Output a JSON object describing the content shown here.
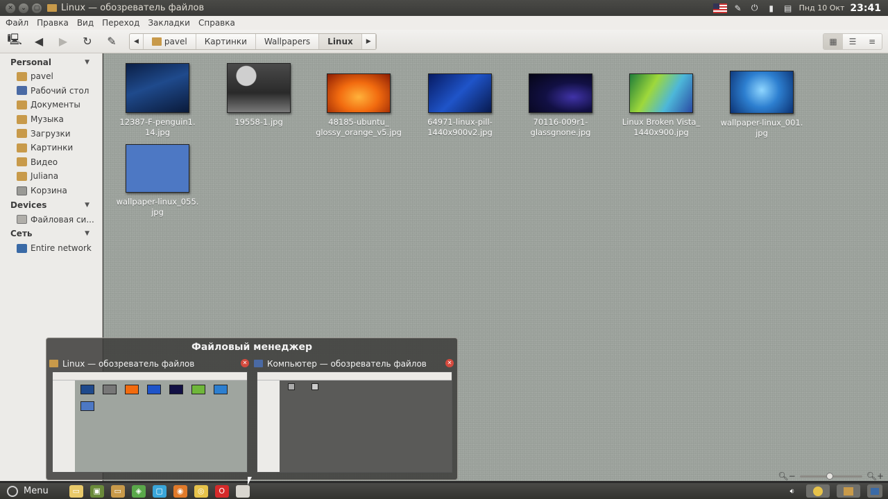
{
  "window": {
    "title": "Linux — обозреватель файлов"
  },
  "tray": {
    "date": "Пнд 10 Окт",
    "time": "23:41"
  },
  "menu": [
    "Файл",
    "Правка",
    "Вид",
    "Переход",
    "Закладки",
    "Справка"
  ],
  "breadcrumb": [
    "pavel",
    "Картинки",
    "Wallpapers",
    "Linux"
  ],
  "sidebar": {
    "personal_header": "Personal",
    "personal": [
      "pavel",
      "Рабочий стол",
      "Документы",
      "Музыка",
      "Загрузки",
      "Картинки",
      "Видео",
      "Juliana",
      "Корзина"
    ],
    "devices_header": "Devices",
    "devices": [
      "Файловая си..."
    ],
    "network_header": "Сеть",
    "network": [
      "Entire network"
    ]
  },
  "files": [
    {
      "name": "12387-F-penguin1.\n14.jpg"
    },
    {
      "name": "19558-1.jpg"
    },
    {
      "name": "48185-ubuntu_\nglossy_orange_v5.jpg"
    },
    {
      "name": "64971-linux-pill-\n1440x900v2.jpg"
    },
    {
      "name": "70116-009r1-\nglassgnone.jpg"
    },
    {
      "name": "Linux Broken Vista_\n1440x900.jpg"
    },
    {
      "name": "wallpaper-linux_001.\njpg"
    },
    {
      "name": "wallpaper-linux_055.\njpg"
    }
  ],
  "switcher": {
    "title": "Файловый менеджер",
    "windows": [
      {
        "title": "Linux — обозреватель файлов"
      },
      {
        "title": "Компьютер — обозреватель файлов"
      }
    ]
  },
  "statusbar": {
    "zoom_level": 0.48
  },
  "taskbar": {
    "menu_label": "Menu"
  }
}
